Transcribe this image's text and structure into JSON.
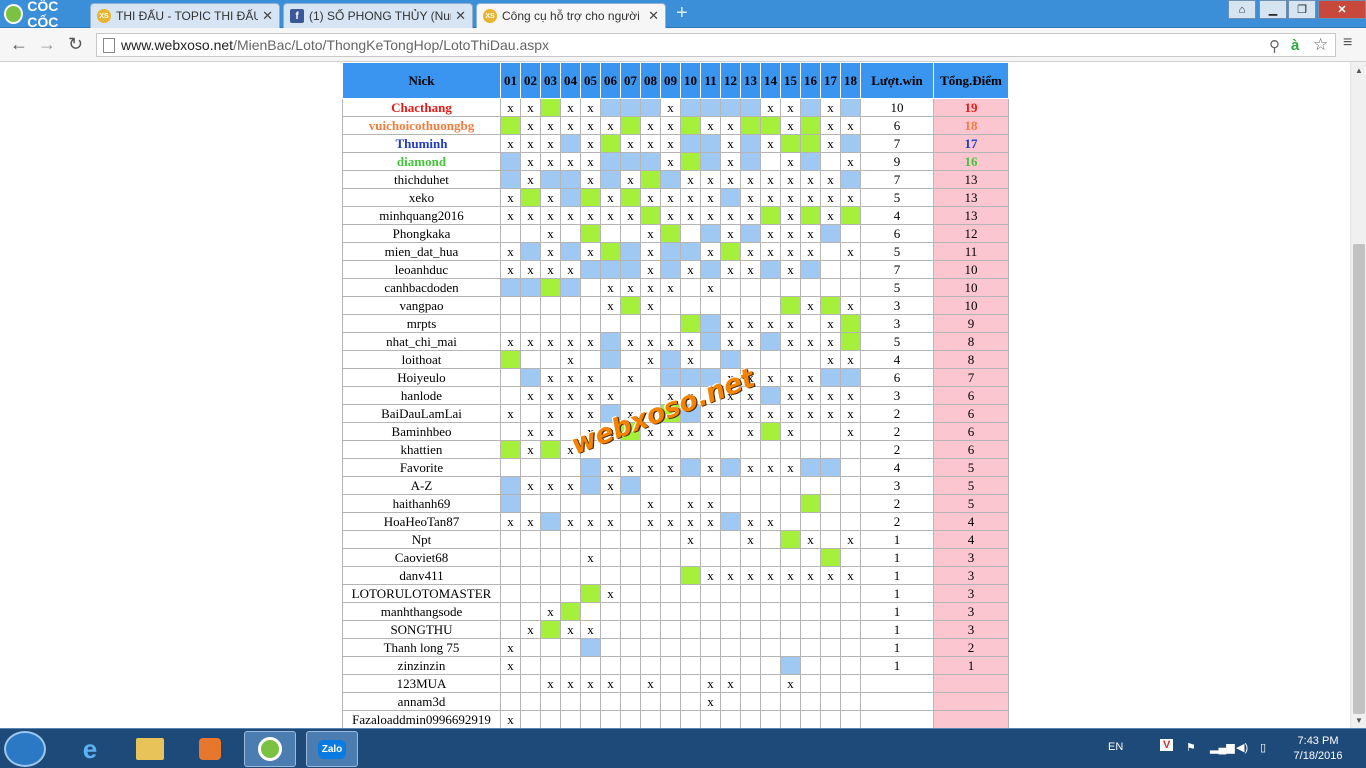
{
  "browser": {
    "brand": "CỐC CỐC",
    "tabs": [
      {
        "title": "THI ĐẤU - TOPIC THI ĐẤU",
        "icon": "xs"
      },
      {
        "title": "(1) SỐ PHONG THỦY (Num",
        "icon": "fb"
      },
      {
        "title": "Công cụ hỗ trợ cho người",
        "icon": "xs"
      }
    ],
    "url_domain": "www.webxoso.net",
    "url_path": "/MienBac/Loto/ThongKeTongHop/LotoThiDau.aspx"
  },
  "table": {
    "headers": {
      "nick": "Nick",
      "cols": [
        "01",
        "02",
        "03",
        "04",
        "05",
        "06",
        "07",
        "08",
        "09",
        "10",
        "11",
        "12",
        "13",
        "14",
        "15",
        "16",
        "17",
        "18"
      ],
      "luot": "Lượt.win",
      "tong": "Tổng.Điểm"
    },
    "highlight_colors": [
      "#e41b17",
      "#f47c3c",
      "#1f3dc7",
      "#43c43a"
    ],
    "rows": [
      {
        "nick": "Chacthang",
        "cells": "xxgxxbbbxbbbbxxbxb",
        "luot": "10",
        "tong": "19"
      },
      {
        "nick": "vuichoicothuongbg",
        "cells": "gxxxxxgxxgxxggxgxx",
        "luot": "6",
        "tong": "18"
      },
      {
        "nick": "Thuminh",
        "cells": "xxxbxgxxxbbxbxggxb",
        "luot": "7",
        "tong": "17"
      },
      {
        "nick": "diamond",
        "cells": "bxxxxbbbxgbxb.xb.x",
        "luot": "9",
        "tong": "16"
      },
      {
        "nick": "thichduhet",
        "cells": "bxbbxbxgbxxxxxxxxb",
        "luot": "7",
        "tong": "13"
      },
      {
        "nick": "xeko",
        "cells": "xgxbgxgxxxxbxxxxxx",
        "luot": "5",
        "tong": "13"
      },
      {
        "nick": "minhquang2016",
        "cells": "xxxxxxxgxxxxxgxgxg",
        "luot": "4",
        "tong": "13"
      },
      {
        "nick": "Phongkaka",
        "cells": "..x.g..xg.bxbxxxb.",
        "luot": "6",
        "tong": "12"
      },
      {
        "nick": "mien_dat_hua",
        "cells": "xbxbxgbxbbxgxxxx.x",
        "luot": "5",
        "tong": "11"
      },
      {
        "nick": "leoanhduc",
        "cells": "xxxxbbbxbxbxxbxb..",
        "luot": "7",
        "tong": "10"
      },
      {
        "nick": "canhbacdoden",
        "cells": "bbgb.xxxx.x.......",
        "luot": "5",
        "tong": "10"
      },
      {
        "nick": "vangpao",
        "cells": ".....xgx......gxgx",
        "luot": "3",
        "tong": "10"
      },
      {
        "nick": "mrpts",
        "cells": ".........gbxxxx.xg",
        "luot": "3",
        "tong": "9"
      },
      {
        "nick": "nhat_chi_mai",
        "cells": "xxxxxbxxxxbxxbxxxg",
        "luot": "5",
        "tong": "8"
      },
      {
        "nick": "loithoat",
        "cells": "g..x.b.xbx.b....xx",
        "luot": "4",
        "tong": "8"
      },
      {
        "nick": "Hoiyeulo",
        "cells": ".bxxx.x.bbbxxxxxbb",
        "luot": "6",
        "tong": "7"
      },
      {
        "nick": "hanlode",
        "cells": ".xxxxx..xx.xxbxxxx",
        "luot": "3",
        "tong": "6"
      },
      {
        "nick": "BaiDauLamLai",
        "cells": "x.xxxbxxgbxxxxxxxx",
        "luot": "2",
        "tong": "6"
      },
      {
        "nick": "Baminhbeo",
        "cells": ".xx.xxgxxxx.xgx..x",
        "luot": "2",
        "tong": "6"
      },
      {
        "nick": "khattien",
        "cells": "gxgx..............",
        "luot": "2",
        "tong": "6"
      },
      {
        "nick": "Favorite",
        "cells": "....bxxxxbxbxxxbb.",
        "luot": "4",
        "tong": "5"
      },
      {
        "nick": "A-Z",
        "cells": "bxxxbxb...........",
        "luot": "3",
        "tong": "5"
      },
      {
        "nick": "haithanh69",
        "cells": "b......x.xx....g..",
        "luot": "2",
        "tong": "5"
      },
      {
        "nick": "HoaHeoTan87",
        "cells": "xxbxxx.xxxxbxx....",
        "luot": "2",
        "tong": "4"
      },
      {
        "nick": "Npt",
        "cells": ".........x..x.gx.x",
        "luot": "1",
        "tong": "4"
      },
      {
        "nick": "Caoviet68",
        "cells": "....x...........g.",
        "luot": "1",
        "tong": "3"
      },
      {
        "nick": "danv411",
        "cells": ".........gxxxxxxxx",
        "luot": "1",
        "tong": "3"
      },
      {
        "nick": "LOTORULOTOMASTER",
        "cells": "....gx............",
        "luot": "1",
        "tong": "3"
      },
      {
        "nick": "manhthangsode",
        "cells": "..xg..............",
        "luot": "1",
        "tong": "3"
      },
      {
        "nick": "SONGTHU",
        "cells": ".xgxx.............",
        "luot": "1",
        "tong": "3"
      },
      {
        "nick": "Thanh long 75",
        "cells": "x...b.............",
        "luot": "1",
        "tong": "2"
      },
      {
        "nick": "zinzinzin",
        "cells": "x.............b...",
        "luot": "1",
        "tong": "1"
      },
      {
        "nick": "123MUA",
        "cells": "..xxxx.x..xx..x...",
        "luot": "",
        "tong": ""
      },
      {
        "nick": "annam3d",
        "cells": "..........x.......",
        "luot": "",
        "tong": ""
      },
      {
        "nick": "Fazaloaddmin0996692919",
        "cells": "x.................",
        "luot": "",
        "tong": ""
      }
    ]
  },
  "watermark": "webxoso.net",
  "taskbar": {
    "lang": "EN",
    "time": "7:43 PM",
    "date": "7/18/2016",
    "zalo": "Zalo"
  }
}
